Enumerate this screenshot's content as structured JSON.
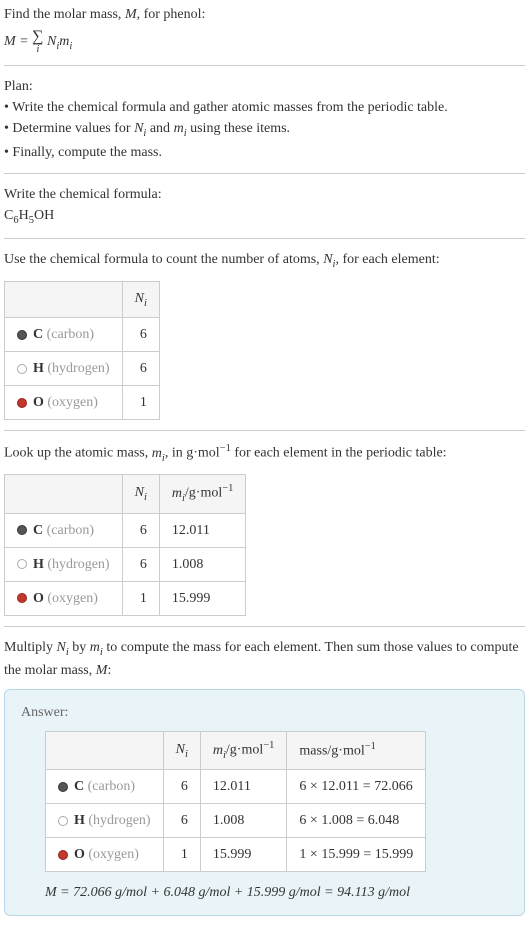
{
  "intro": {
    "line1": "Find the molar mass, ",
    "line1_var": "M",
    "line1_end": ", for phenol:",
    "formula_M": "M",
    "formula_eq": " = ",
    "formula_Ni": "N",
    "formula_mi": "m",
    "formula_i": "i"
  },
  "plan": {
    "heading": "Plan:",
    "item1": "• Write the chemical formula and gather atomic masses from the periodic table.",
    "item2_a": "• Determine values for ",
    "item2_b": " and ",
    "item2_c": " using these items.",
    "item3": "• Finally, compute the mass."
  },
  "chemformula": {
    "heading": "Write the chemical formula:",
    "c": "C",
    "c_sub": "6",
    "h": "H",
    "h_sub": "5",
    "oh": "OH"
  },
  "count": {
    "heading_a": "Use the chemical formula to count the number of atoms, ",
    "heading_b": ", for each element:",
    "header_Ni": "N",
    "header_i": "i",
    "rows": [
      {
        "sym": "C",
        "name": "(carbon)",
        "Ni": "6"
      },
      {
        "sym": "H",
        "name": "(hydrogen)",
        "Ni": "6"
      },
      {
        "sym": "O",
        "name": "(oxygen)",
        "Ni": "1"
      }
    ]
  },
  "atomicmass": {
    "heading_a": "Look up the atomic mass, ",
    "heading_b": ", in g·mol",
    "heading_exp": "−1",
    "heading_c": " for each element in the periodic table:",
    "header_mi": "m",
    "header_unit": "/g·mol",
    "rows": [
      {
        "sym": "C",
        "name": "(carbon)",
        "Ni": "6",
        "mi": "12.011"
      },
      {
        "sym": "H",
        "name": "(hydrogen)",
        "Ni": "6",
        "mi": "1.008"
      },
      {
        "sym": "O",
        "name": "(oxygen)",
        "Ni": "1",
        "mi": "15.999"
      }
    ]
  },
  "multiply": {
    "heading_a": "Multiply ",
    "heading_b": " by ",
    "heading_c": " to compute the mass for each element. Then sum those values to compute the molar mass, ",
    "heading_d": ":"
  },
  "answer": {
    "label": "Answer:",
    "header_mass": "mass/g·mol",
    "rows": [
      {
        "sym": "C",
        "name": "(carbon)",
        "Ni": "6",
        "mi": "12.011",
        "mass": "6 × 12.011 = 72.066"
      },
      {
        "sym": "H",
        "name": "(hydrogen)",
        "Ni": "6",
        "mi": "1.008",
        "mass": "6 × 1.008 = 6.048"
      },
      {
        "sym": "O",
        "name": "(oxygen)",
        "Ni": "1",
        "mi": "15.999",
        "mass": "1 × 15.999 = 15.999"
      }
    ],
    "final": "M = 72.066 g/mol + 6.048 g/mol + 15.999 g/mol = 94.113 g/mol"
  }
}
